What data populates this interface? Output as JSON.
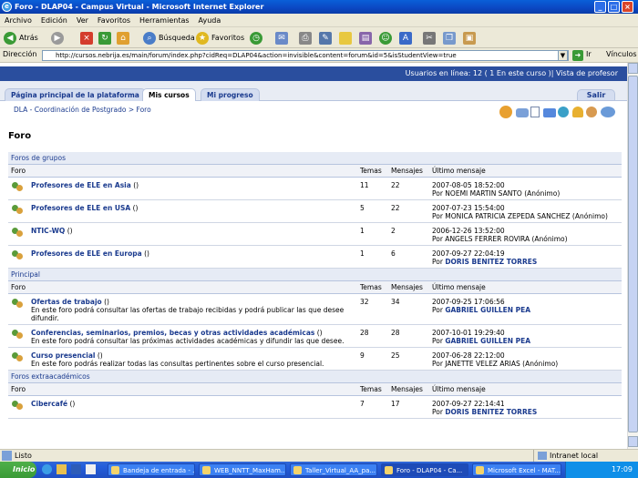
{
  "window": {
    "title": "Foro - DLAP04 - Campus Virtual - Microsoft Internet Explorer"
  },
  "menu": [
    "Archivo",
    "Edición",
    "Ver",
    "Favoritos",
    "Herramientas",
    "Ayuda"
  ],
  "toolbar": {
    "back": "Atrás",
    "search": "Búsqueda",
    "favorites": "Favoritos"
  },
  "address": {
    "label": "Dirección",
    "url": "http://cursos.nebrija.es/main/forum/index.php?cidReq=DLAP04&action=invisible&content=forum&id=5&isStudentView=true",
    "go": "Ir",
    "links": "Vínculos"
  },
  "site": {
    "online": "Usuarios en línea: 12 ( 1 En este curso )| Vista de profesor",
    "tabs": [
      "Página principal de la plataforma",
      "Mis cursos",
      "Mi progreso"
    ],
    "logout": "Salir",
    "breadcrumb": "DLA - Coordinación de Postgrado > Foro",
    "title": "Foro"
  },
  "columns": {
    "foro": "Foro",
    "temas": "Temas",
    "mensajes": "Mensajes",
    "ultimo": "Último mensaje"
  },
  "sections": [
    {
      "name": "Foros de grupos",
      "rows": [
        {
          "name": "Profesores de ELE en Asia",
          "count": "()",
          "desc": "",
          "temas": "11",
          "mensajes": "22",
          "date": "2007-08-05 18:52:00",
          "by": "Por NOEMI MARTIN SANTO (Anónimo)",
          "link": ""
        },
        {
          "name": "Profesores de ELE en USA",
          "count": "()",
          "desc": "",
          "temas": "5",
          "mensajes": "22",
          "date": "2007-07-23 15:54:00",
          "by": "Por MONICA PATRICIA ZEPEDA SANCHEZ (Anónimo)",
          "link": ""
        },
        {
          "name": "NTIC-WQ",
          "count": "()",
          "desc": "",
          "temas": "1",
          "mensajes": "2",
          "date": "2006-12-26 13:52:00",
          "by": "Por ANGELS FERRER ROVIRA (Anónimo)",
          "link": ""
        },
        {
          "name": "Profesores de ELE en Europa",
          "count": "()",
          "desc": "",
          "temas": "1",
          "mensajes": "6",
          "date": "2007-09-27 22:04:19",
          "by": "Por ",
          "link": "DORIS BENITEZ TORRES"
        }
      ]
    },
    {
      "name": "Principal",
      "rows": [
        {
          "name": "Ofertas de trabajo",
          "count": "()",
          "desc": "En este foro podrá consultar las ofertas de trabajo recibidas y podrá publicar las que desee difundir.",
          "temas": "32",
          "mensajes": "34",
          "date": "2007-09-25 17:06:56",
          "by": "Por ",
          "link": "GABRIEL GUILLEN PEA"
        },
        {
          "name": "Conferencias, seminarios, premios, becas y otras actividades académicas",
          "count": "()",
          "desc": "En este foro podrá consultar las próximas actividades académicas y difundir las que desee.",
          "temas": "28",
          "mensajes": "28",
          "date": "2007-10-01 19:29:40",
          "by": "Por ",
          "link": "GABRIEL GUILLEN PEA"
        },
        {
          "name": "Curso presencial",
          "count": "()",
          "desc": "En este foro podrás realizar todas las consultas pertinentes sobre el curso presencial.",
          "temas": "9",
          "mensajes": "25",
          "date": "2007-06-28 22:12:00",
          "by": "Por JANETTE VELEZ ARIAS (Anónimo)",
          "link": ""
        }
      ]
    },
    {
      "name": "Foros extraacadémicos",
      "rows": [
        {
          "name": "Cibercafé",
          "count": "()",
          "desc": "",
          "temas": "7",
          "mensajes": "17",
          "date": "2007-09-27 22:14:41",
          "by": "Por ",
          "link": "DORIS BENITEZ TORRES"
        }
      ]
    }
  ],
  "status": {
    "left": "Listo",
    "right": "Intranet local"
  },
  "taskbar": {
    "start": "Inicio",
    "items": [
      "Bandeja de entrada - ...",
      "WEB_NNTT_MaxHam...",
      "Taller_Virtual_AA_pa...",
      "Foro - DLAP04 - Ca...",
      "Microsoft Excel - MAT..."
    ],
    "clock": "17:09"
  }
}
